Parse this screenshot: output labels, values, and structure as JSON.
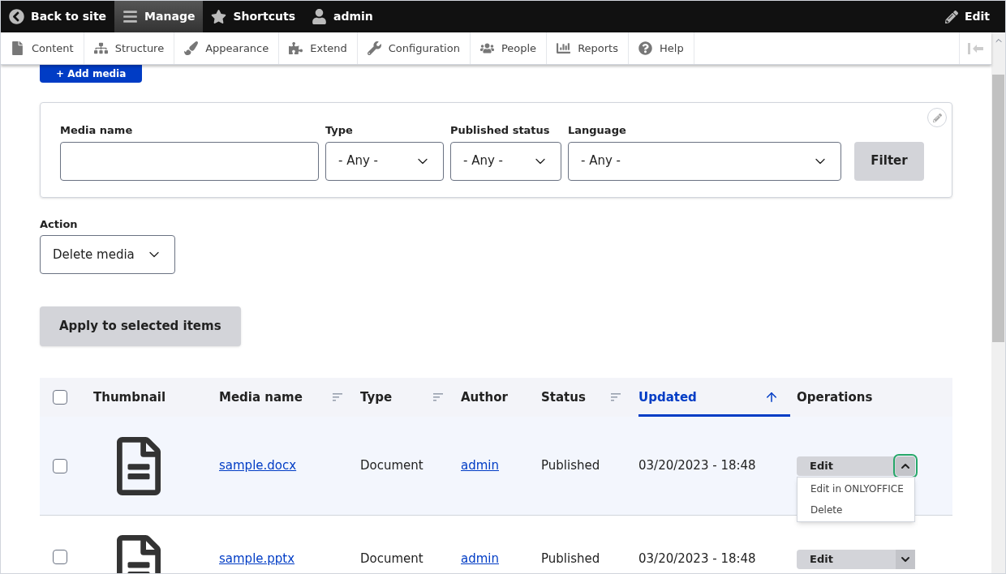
{
  "toolbar": {
    "items": [
      {
        "label": "Back to site",
        "selected": false
      },
      {
        "label": "Manage",
        "selected": true
      },
      {
        "label": "Shortcuts",
        "selected": false
      },
      {
        "label": "admin",
        "selected": false
      }
    ],
    "edit": "Edit"
  },
  "admin_menu": {
    "items": [
      "Content",
      "Structure",
      "Appearance",
      "Extend",
      "Configuration",
      "People",
      "Reports",
      "Help"
    ]
  },
  "add_media_button": "+ Add media",
  "filters": {
    "fields": [
      {
        "kind": "text",
        "label": "Media name"
      },
      {
        "kind": "select",
        "label": "Type",
        "value": "- Any -"
      },
      {
        "kind": "select",
        "label": "Published status",
        "value": "- Any -"
      },
      {
        "kind": "select",
        "label": "Language",
        "value": "- Any -"
      }
    ],
    "button": "Filter"
  },
  "action": {
    "label": "Action",
    "value": "Delete media"
  },
  "apply_button": "Apply to selected items",
  "table": {
    "all_checked": false,
    "columns": [
      {
        "label": "Thumbnail",
        "sortable": false,
        "selected": false
      },
      {
        "label": "Media name",
        "sortable": true,
        "selected": false
      },
      {
        "label": "Type",
        "sortable": true,
        "selected": false
      },
      {
        "label": "Author",
        "sortable": false,
        "selected": false
      },
      {
        "label": "Status",
        "sortable": true,
        "selected": false
      },
      {
        "label": "Updated",
        "sortable": true,
        "selected": true
      },
      {
        "label": "Operations",
        "sortable": false,
        "selected": false
      }
    ],
    "rows": [
      {
        "checked": false,
        "name": "sample.docx",
        "type": "Document",
        "author": "admin",
        "status": "Published",
        "updated": "03/20/2023 - 18:48",
        "operation": "Edit",
        "expanded": true,
        "menu": [
          "Edit in ONLYOFFICE",
          "Delete"
        ]
      },
      {
        "checked": false,
        "name": "sample.pptx",
        "type": "Document",
        "author": "admin",
        "status": "Published",
        "updated": "03/20/2023 - 18:48",
        "operation": "Edit",
        "expanded": false,
        "menu": []
      }
    ]
  }
}
